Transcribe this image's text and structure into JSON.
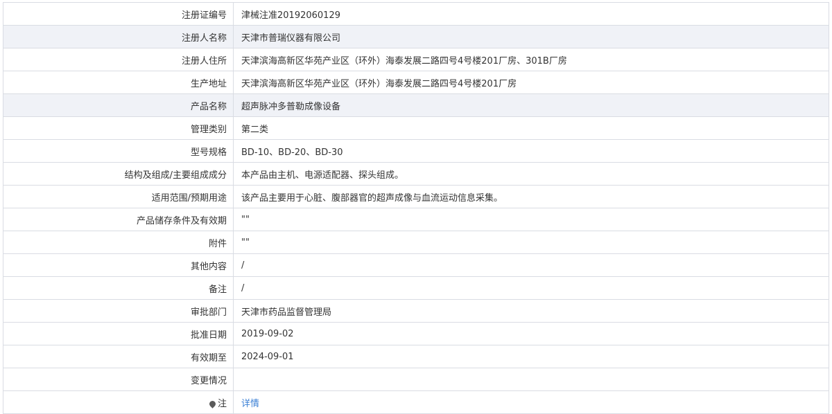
{
  "rows": [
    {
      "label": "注册证编号",
      "value": "津械注准20192060129"
    },
    {
      "label": "注册人名称",
      "value": "天津市普瑞仪器有限公司"
    },
    {
      "label": "注册人住所",
      "value": "天津滨海高新区华苑产业区（环外）海泰发展二路四号4号楼201厂房、301B厂房"
    },
    {
      "label": "生产地址",
      "value": "天津滨海高新区华苑产业区（环外）海泰发展二路四号4号楼201厂房"
    },
    {
      "label": "产品名称",
      "value": "超声脉冲多普勒成像设备"
    },
    {
      "label": "管理类别",
      "value": "第二类"
    },
    {
      "label": "型号规格",
      "value": "BD-10、BD-20、BD-30"
    },
    {
      "label": "结构及组成/主要组成成分",
      "value": "本产品由主机、电源适配器、探头组成。"
    },
    {
      "label": "适用范围/预期用途",
      "value": "该产品主要用于心脏、腹部器官的超声成像与血流运动信息采集。"
    },
    {
      "label": "产品储存条件及有效期",
      "value": "\"\""
    },
    {
      "label": "附件",
      "value": "\"\""
    },
    {
      "label": "其他内容",
      "value": "/"
    },
    {
      "label": "备注",
      "value": "/"
    },
    {
      "label": "审批部门",
      "value": "天津市药品监督管理局"
    },
    {
      "label": "批准日期",
      "value": "2019-09-02"
    },
    {
      "label": "有效期至",
      "value": "2024-09-01"
    },
    {
      "label": "变更情况",
      "value": ""
    }
  ],
  "note": {
    "label": "注",
    "link": "详情"
  }
}
